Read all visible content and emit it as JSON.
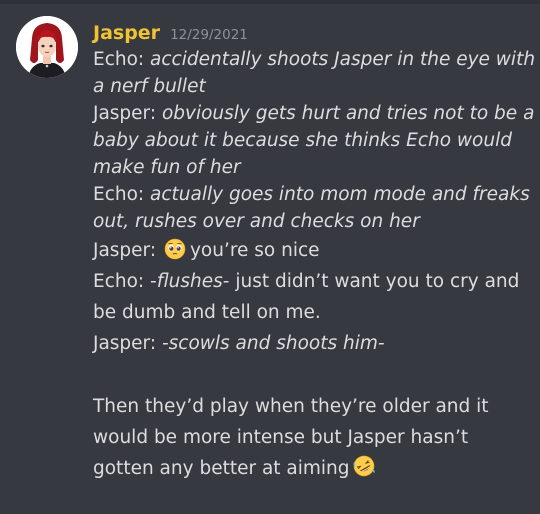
{
  "message": {
    "author": "Jasper",
    "timestamp": "12/29/2021",
    "author_color": "#f1c232",
    "lines": [
      {
        "speaker": "Echo: ",
        "italic": "accidentally shoots Jasper in the eye with"
      },
      {
        "italic": "a nerf bullet"
      },
      {
        "speaker": "Jasper: ",
        "italic": "obviously gets hurt and tries not to be a"
      },
      {
        "italic": "baby about it because she thinks Echo would"
      },
      {
        "italic": "make fun of her"
      },
      {
        "speaker": "Echo: ",
        "italic": "actually goes into mom mode and freaks"
      },
      {
        "italic": "out, rushes over and checks on her"
      },
      {
        "speaker": "Jasper: ",
        "emoji": "pleading-face-emoji",
        "text": "you’re so nice"
      },
      {
        "speaker": "Echo: ",
        "pre": "-",
        "italic": "flushes",
        "post": "- just didn’t want you to cry and"
      },
      {
        "text": "be dumb and tell on me."
      },
      {
        "speaker": "Jasper: ",
        "italic": "-scowls and shoots him-"
      },
      {
        "text": "Then they’d play when they’re older and it"
      },
      {
        "text": "would be more intense but Jasper hasn’t"
      },
      {
        "text": "gotten any better at aiming",
        "emoji": "rolling-on-floor-laughing-emoji"
      }
    ]
  }
}
